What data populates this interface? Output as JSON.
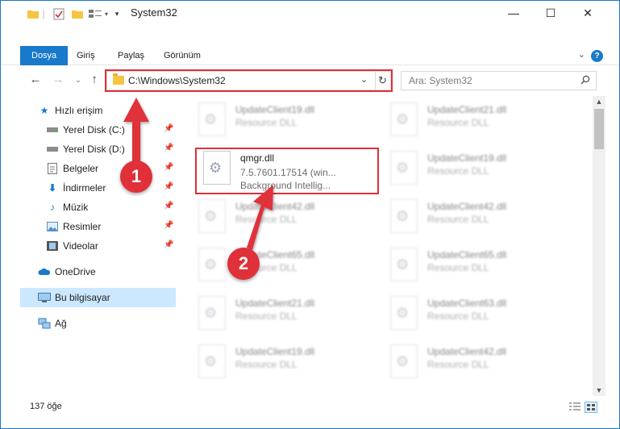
{
  "window": {
    "title": "System32",
    "controls": {
      "minimize": "—",
      "maximize": "☐",
      "close": "✕"
    }
  },
  "ribbon": {
    "tabs": [
      "Dosya",
      "Giriş",
      "Paylaş",
      "Görünüm"
    ],
    "help": "?"
  },
  "address": {
    "path": "C:\\Windows\\System32",
    "search_placeholder": "Ara: System32"
  },
  "nav": {
    "items": [
      {
        "label": "Hızlı erişim",
        "icon": "star-icon",
        "pinned": false
      },
      {
        "label": "Yerel Disk (C:)",
        "icon": "drive-icon",
        "pinned": true
      },
      {
        "label": "Yerel Disk (D:)",
        "icon": "drive-icon",
        "pinned": true
      },
      {
        "label": "Belgeler",
        "icon": "documents-icon",
        "pinned": true
      },
      {
        "label": "İndirmeler",
        "icon": "download-icon",
        "pinned": true
      },
      {
        "label": "Müzik",
        "icon": "music-icon",
        "pinned": true
      },
      {
        "label": "Resimler",
        "icon": "pictures-icon",
        "pinned": true
      },
      {
        "label": "Videolar",
        "icon": "videos-icon",
        "pinned": true
      },
      {
        "label": "OneDrive",
        "icon": "cloud-icon",
        "pinned": false
      },
      {
        "label": "Bu bilgisayar",
        "icon": "computer-icon",
        "pinned": false
      },
      {
        "label": "Ağ",
        "icon": "network-icon",
        "pinned": false
      }
    ]
  },
  "files": {
    "focused": {
      "name": "qmgr.dll",
      "version": "7.5.7601.17514 (win...",
      "desc": "Background Intellig..."
    },
    "left_column": [
      {
        "name": "UpdateClient19.dll",
        "desc": "Resource DLL"
      },
      {
        "name": "UpdateClient42.dll",
        "desc": "Resource DLL"
      },
      {
        "name": "UpdateClient65.dll",
        "desc": "Resource DLL"
      },
      {
        "name": "UpdateClient21.dll",
        "desc": "Resource DLL"
      },
      {
        "name": "UpdateClient19.dll",
        "desc": "Resource DLL"
      }
    ],
    "right_column": [
      {
        "name": "UpdateClient21.dll",
        "desc": "Resource DLL"
      },
      {
        "name": "UpdateClient19.dll",
        "desc": "Resource DLL"
      },
      {
        "name": "UpdateClient42.dll",
        "desc": "Resource DLL"
      },
      {
        "name": "UpdateClient65.dll",
        "desc": "Resource DLL"
      },
      {
        "name": "UpdateClient63.dll",
        "desc": "Resource DLL"
      },
      {
        "name": "UpdateClient42.dll",
        "desc": "Resource DLL"
      }
    ]
  },
  "status": {
    "count": "137 öğe"
  },
  "annotations": {
    "step1": "1",
    "step2": "2"
  },
  "colors": {
    "accent": "#1979ca",
    "highlight": "#e0303a",
    "selected": "#cce8ff"
  }
}
